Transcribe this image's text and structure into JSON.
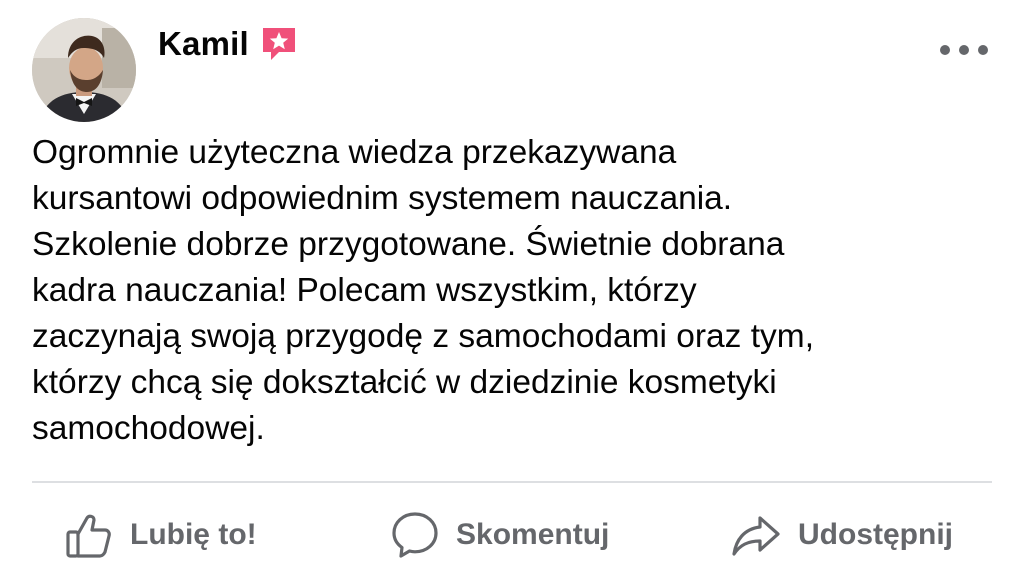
{
  "author": {
    "name": "Kamil",
    "badge_icon": "star-badge-icon",
    "badge_color": "#f0507a"
  },
  "post": {
    "text": "Ogromnie użyteczna wiedza przekazywana\nkursantowi odpowiednim systemem nauczania.\nSzkolenie dobrze przygotowane. Świetnie dobrana\nkadra nauczania! Polecam wszystkim, którzy\nzaczynają swoją przygodę z samochodami oraz tym,\nktórzy chcą się dokształcić w dziedzinie kosmetyki\nsamochodowej."
  },
  "actions": {
    "like": {
      "label": "Lubię to!",
      "icon": "thumbs-up-icon"
    },
    "comment": {
      "label": "Skomentuj",
      "icon": "comment-bubble-icon"
    },
    "share": {
      "label": "Udostępnij",
      "icon": "share-arrow-icon"
    }
  },
  "menu": {
    "icon": "more-options-icon"
  },
  "colors": {
    "text": "#050505",
    "secondary": "#65676b",
    "divider": "#dddfe2"
  }
}
